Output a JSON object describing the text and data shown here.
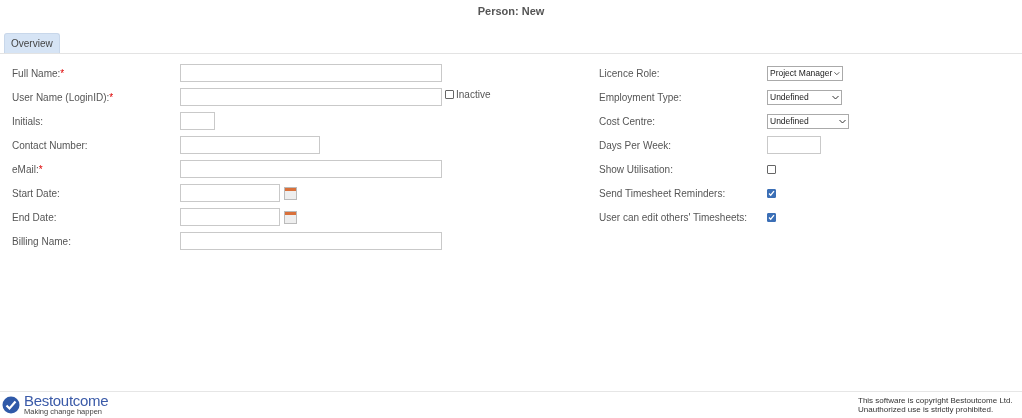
{
  "title": "Person: New",
  "tabs": [
    {
      "label": "Overview",
      "selected": true
    }
  ],
  "left_fields": [
    {
      "label": "Full Name:",
      "required_mark": "*",
      "kind": "wide"
    },
    {
      "label": "User Name (LoginID):",
      "required_mark": "*",
      "kind": "wide",
      "checkbox": {
        "label": "Inactive",
        "checked": false
      }
    },
    {
      "label": "Initials:",
      "kind": "tiny"
    },
    {
      "label": "Contact Number:",
      "kind": "medium"
    },
    {
      "label": "eMail:",
      "required_mark": "*",
      "kind": "wide"
    },
    {
      "label": "Start Date:",
      "kind": "date"
    },
    {
      "label": "End Date:",
      "kind": "date"
    },
    {
      "label": "Billing Name:",
      "kind": "wide"
    }
  ],
  "right_fields": [
    {
      "label": "Licence Role:",
      "kind": "select",
      "value": "Project Manager"
    },
    {
      "label": "Employment Type:",
      "kind": "select",
      "value": "Undefined"
    },
    {
      "label": "Cost Centre:",
      "kind": "select",
      "value": "Undefined"
    },
    {
      "label": "Days Per Week:",
      "kind": "text"
    },
    {
      "label": "Show Utilisation:",
      "kind": "checkbox",
      "checked": false
    },
    {
      "label": "Send Timesheet Reminders:",
      "kind": "checkbox",
      "checked": true
    },
    {
      "label": "User can edit others' Timesheets:",
      "kind": "checkbox",
      "checked": true
    }
  ],
  "footer": {
    "brand": "Bestoutcome",
    "tagline": "Making change happen",
    "copyright": "This software is copyright Bestoutcome Ltd.",
    "notice": "Unauthorized use is strictly prohibited."
  }
}
